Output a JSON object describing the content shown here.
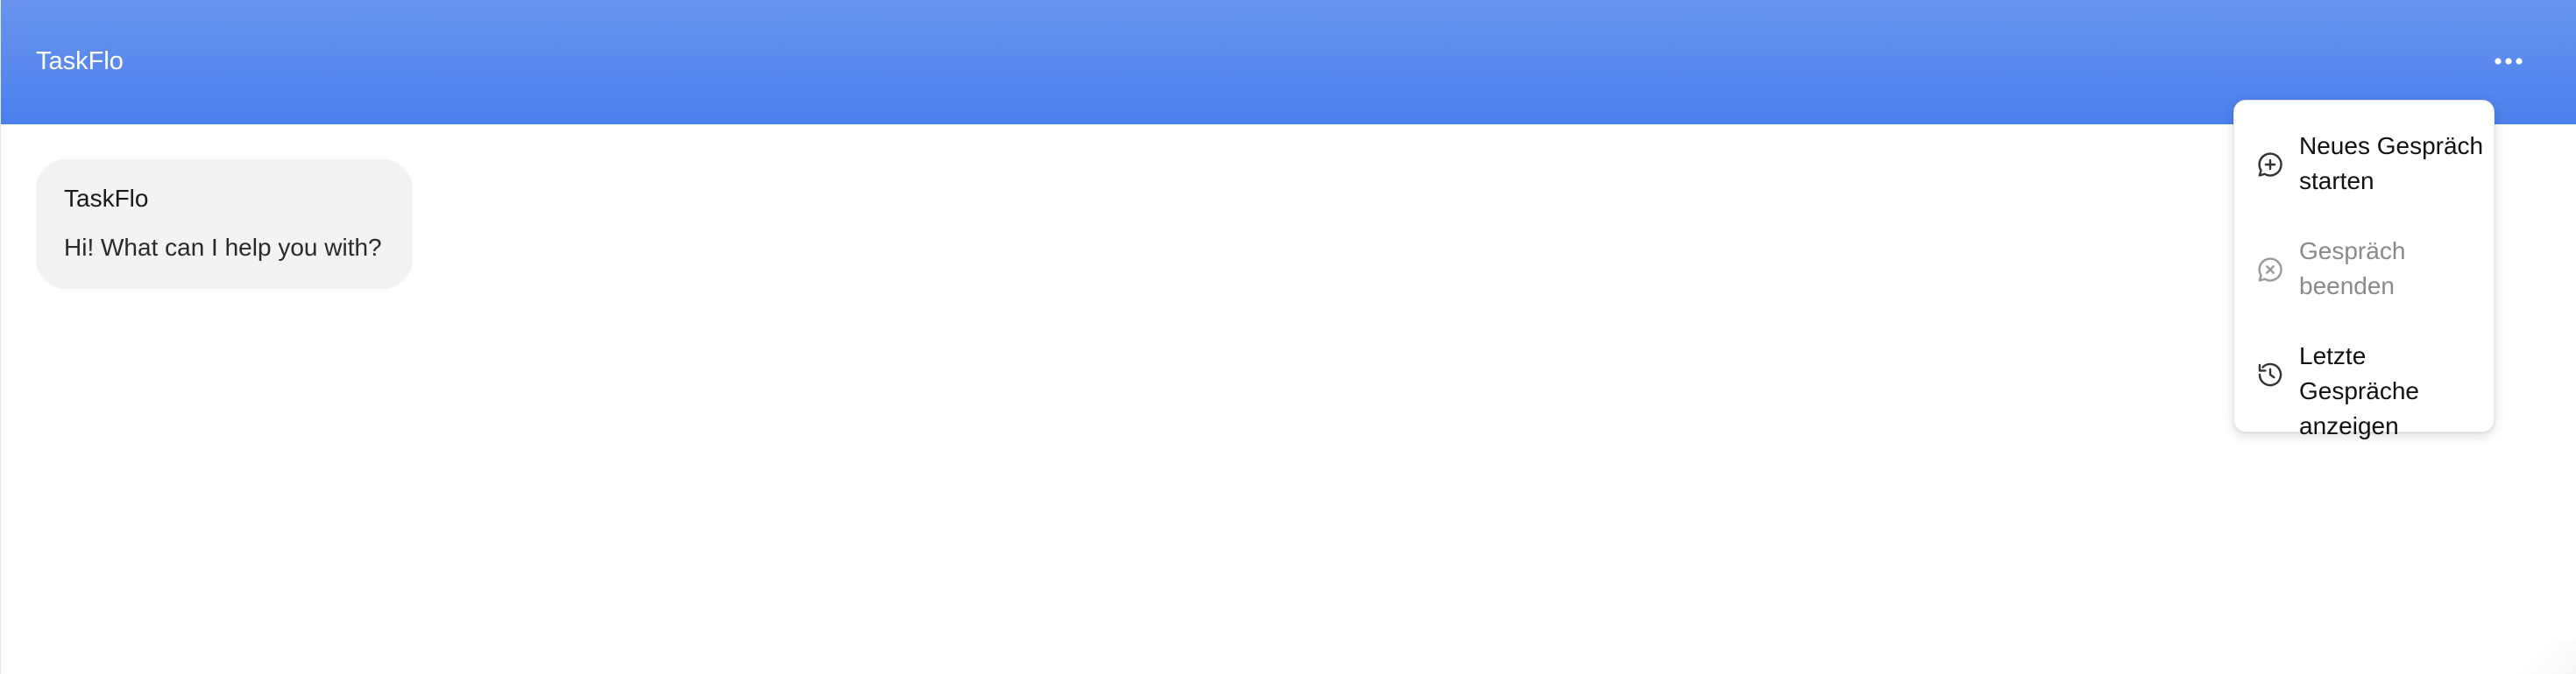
{
  "header": {
    "title": "TaskFlo",
    "menu_icon": "more-horizontal-icon",
    "gradient_top": "#6894f0",
    "gradient_bottom": "#4c80ec"
  },
  "chat": {
    "messages": [
      {
        "sender": "TaskFlo",
        "text": "Hi! What can I help you with?"
      }
    ]
  },
  "menu": {
    "items": [
      {
        "label": "Neues Gespräch starten",
        "icon": "chat-plus-icon",
        "enabled": true
      },
      {
        "label": "Gespräch beenden",
        "icon": "chat-close-icon",
        "enabled": false
      },
      {
        "label": "Letzte Gespräche anzeigen",
        "icon": "history-icon",
        "enabled": true
      }
    ]
  }
}
